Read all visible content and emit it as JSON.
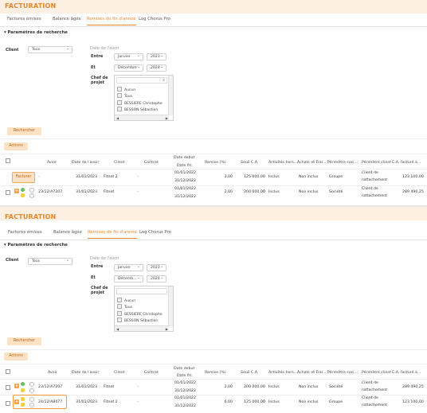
{
  "header": {
    "title": "FACTURATION"
  },
  "tabs": [
    {
      "label": "Factures émises",
      "active": false
    },
    {
      "label": "Balance âgée",
      "active": false
    },
    {
      "label": "Remises de fin d'année",
      "active": true
    },
    {
      "label": "Log Chorus Pro",
      "active": false
    }
  ],
  "search": {
    "section_label": "▾ Paramètres de recherche",
    "client_label": "Client",
    "client_value": "Tous",
    "date_label": "Date de l'avoir",
    "entre_label": "Entre",
    "et_label": "Et",
    "from_month": "Janvier",
    "from_year": "2023",
    "to_month": "Décembre",
    "to_month_short": "Décemb...",
    "to_year": "2024",
    "chef_label_1": "Chef de",
    "chef_label_2": "projet",
    "chef_items": [
      "Aucun",
      "Tous",
      "BESSIERE Christophe",
      "BESSON Sébastien"
    ],
    "search_button": "Rechercher",
    "actions_button": "Actions"
  },
  "table": {
    "headers": {
      "avoir": "Avoir",
      "date_avoir": "Date de l'avoir",
      "client": "Client",
      "contrat": "Contrat",
      "date_debut": "Date debut",
      "date_fin": "Date fin",
      "remise": "Remise (%)",
      "seuil": "Seuil C.A.",
      "activites": "Activités hors...",
      "achats": "Achats et Frai...",
      "perimetre_soc": "Périmètre soci...",
      "perimetre_client": "Périmètre client",
      "ca_facture": "C.A. facturé à..."
    },
    "facturer_button": "Facturer"
  },
  "panel1": {
    "rows": [
      {
        "avoir": "-",
        "date_avoir": "31/01/2023",
        "client": "Fitnet 2",
        "contrat": "-",
        "date_debut": "01/01/2022",
        "date_fin": "31/12/2022",
        "remise": "3,00",
        "seuil": "125 000,00",
        "activites": "Inclus",
        "achats": "Non inclus",
        "perimetre_soc": "Groupe",
        "perimetre_client_1": "Client de",
        "perimetre_client_2": "rattachement",
        "ca": "123 100,00"
      },
      {
        "avoir": "23/12/A7207",
        "date_avoir": "31/01/2023",
        "client": "Fitnet",
        "contrat": "-",
        "date_debut": "01/01/2022",
        "date_fin": "31/12/2022",
        "remise": "2,00",
        "seuil": "200 000,00",
        "activites": "Inclus",
        "achats": "Non inclus",
        "perimetre_soc": "Société",
        "perimetre_client_1": "Client de",
        "perimetre_client_2": "rattachement",
        "ca": "289 490,25"
      }
    ]
  },
  "panel2": {
    "rows": [
      {
        "avoir": "23/12/A7207",
        "date_avoir": "31/01/2023",
        "client": "Fitnet",
        "contrat": "-",
        "date_debut": "01/01/2022",
        "date_fin": "31/12/2022",
        "remise": "2,00",
        "seuil": "200 000,00",
        "activites": "Inclus",
        "achats": "Non inclus",
        "perimetre_soc": "Société",
        "perimetre_client_1": "Client de",
        "perimetre_client_2": "rattachement",
        "ca": "289 490,25"
      },
      {
        "avoir": "24/12/A8477",
        "date_avoir": "31/01/2023",
        "client": "Fitnet 2",
        "contrat": "-",
        "date_debut": "01/01/2022",
        "date_fin": "31/12/2022",
        "remise": "6,00",
        "seuil": "125 000,00",
        "activites": "Inclus",
        "achats": "Non inclus",
        "perimetre_soc": "Groupe",
        "perimetre_client_1": "Client de",
        "perimetre_client_2": "rattachement",
        "ca": "123 100,00"
      }
    ]
  },
  "colors": {
    "accent": "#e8862a",
    "header_bg": "#fdf0e3",
    "button_bg": "#fde2c4"
  }
}
